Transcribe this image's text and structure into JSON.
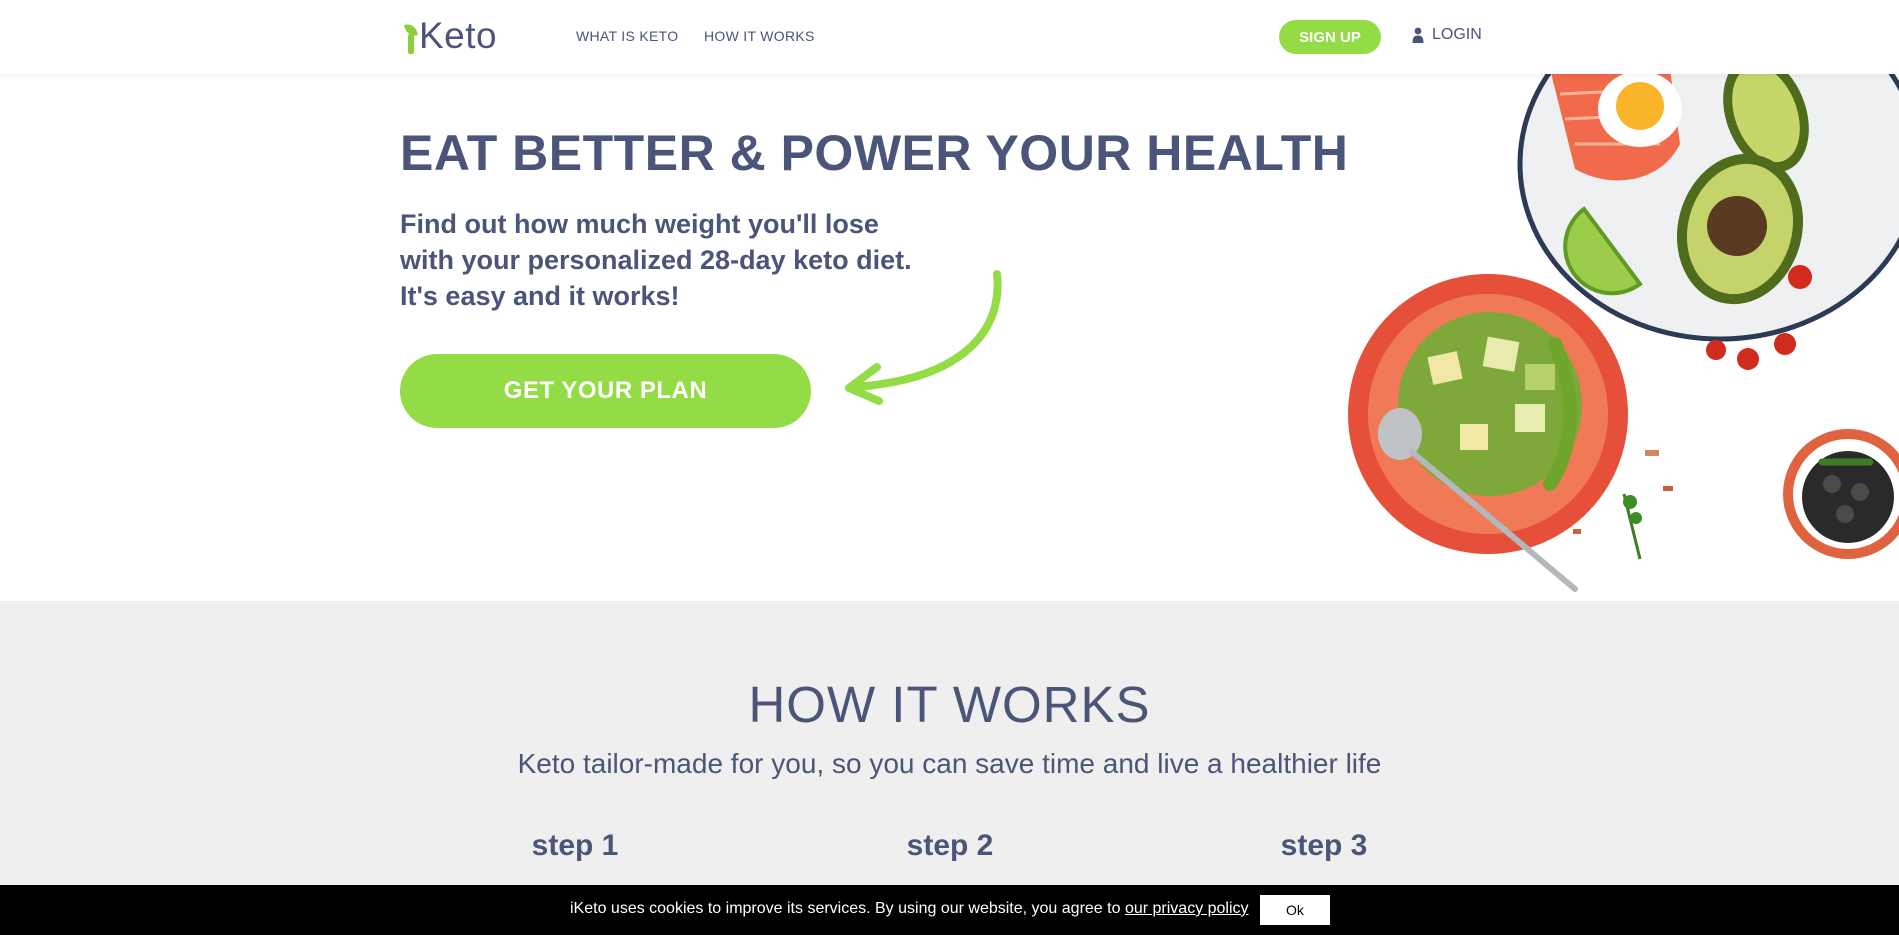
{
  "header": {
    "logo_text": "Keto",
    "nav": {
      "what_is_keto": "WHAT IS KETO",
      "how_it_works": "HOW IT WORKS"
    },
    "signup_label": "SIGN UP",
    "login_label": "LOGIN"
  },
  "hero": {
    "title": "EAT BETTER & POWER YOUR HEALTH",
    "subtitle": "Find out how much weight you'll lose with your personalized 28-day keto diet. It's easy and it works!",
    "cta_label": "GET YOUR PLAN"
  },
  "how": {
    "title": "HOW IT WORKS",
    "subtitle": "Keto tailor-made for you, so you can save time and live a healthier life",
    "steps": [
      "step 1",
      "step 2",
      "step 3"
    ]
  },
  "cookie": {
    "text": "iKeto uses cookies to improve its services. By using our website, you agree to ",
    "link": "our privacy policy",
    "ok_label": "Ok"
  },
  "colors": {
    "brand_green": "#93dc45",
    "text_navy": "#4a5579",
    "section_gray": "#efefef",
    "cookie_bg": "#000000"
  },
  "icons": [
    "leaf-logo-icon",
    "user-icon",
    "curved-arrow-icon"
  ]
}
